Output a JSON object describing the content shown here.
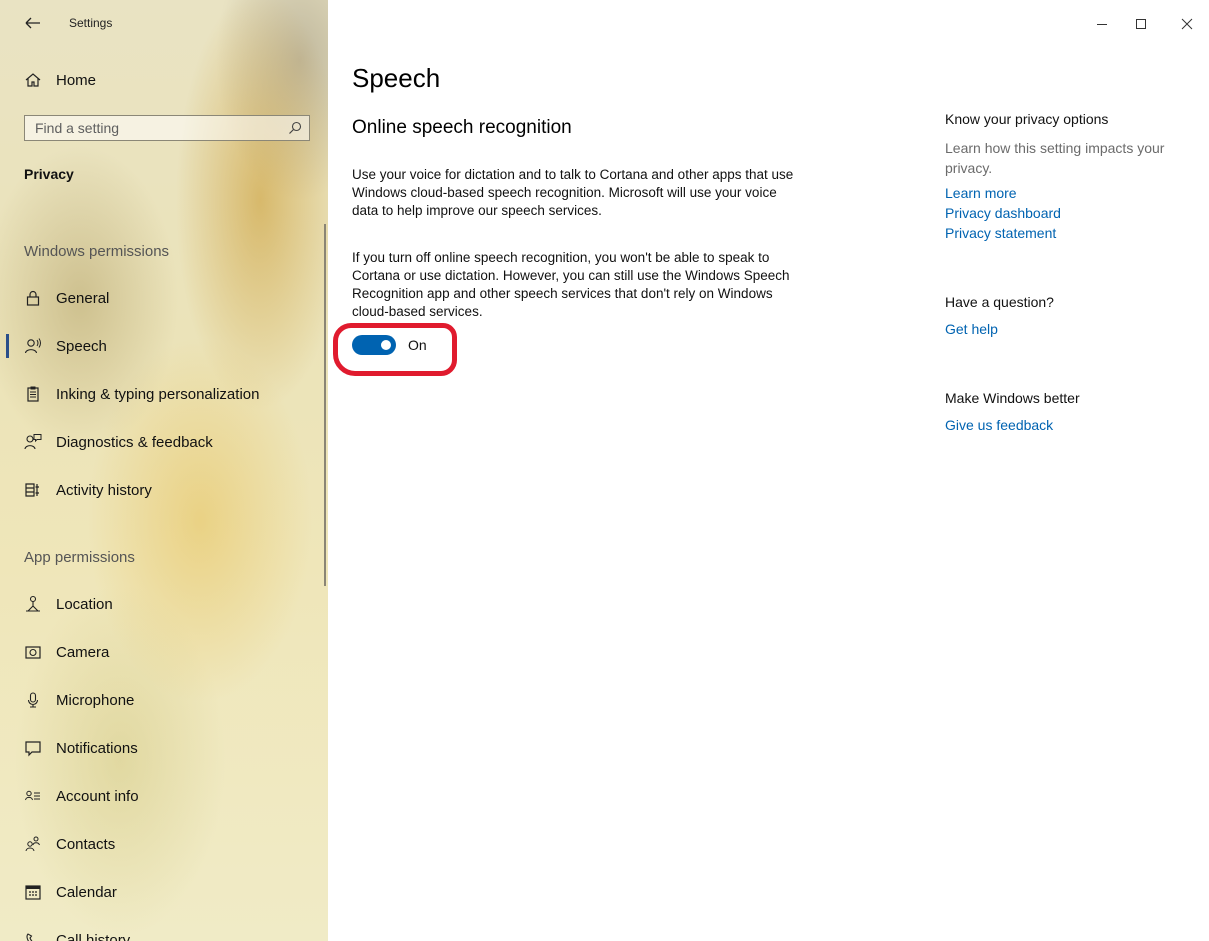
{
  "window": {
    "title": "Settings",
    "controls": {
      "minimize": "minimize",
      "maximize": "maximize",
      "close": "close"
    }
  },
  "sidebar": {
    "home_label": "Home",
    "search_placeholder": "Find a setting",
    "category": "Privacy",
    "sections": [
      {
        "heading": "Windows permissions",
        "items": [
          {
            "label": "General",
            "icon": "lock-icon"
          },
          {
            "label": "Speech",
            "icon": "speech-icon",
            "selected": true
          },
          {
            "label": "Inking & typing personalization",
            "icon": "clipboard-icon"
          },
          {
            "label": "Diagnostics & feedback",
            "icon": "feedback-icon"
          },
          {
            "label": "Activity history",
            "icon": "activity-icon"
          }
        ]
      },
      {
        "heading": "App permissions",
        "items": [
          {
            "label": "Location",
            "icon": "location-icon"
          },
          {
            "label": "Camera",
            "icon": "camera-icon"
          },
          {
            "label": "Microphone",
            "icon": "microphone-icon"
          },
          {
            "label": "Notifications",
            "icon": "notifications-icon"
          },
          {
            "label": "Account info",
            "icon": "account-info-icon"
          },
          {
            "label": "Contacts",
            "icon": "contacts-icon"
          },
          {
            "label": "Calendar",
            "icon": "calendar-icon"
          },
          {
            "label": "Call history",
            "icon": "call-history-icon"
          }
        ]
      }
    ]
  },
  "main": {
    "title": "Speech",
    "subtitle": "Online speech recognition",
    "paragraph1": "Use your voice for dictation and to talk to Cortana and other apps that use Windows cloud-based speech recognition. Microsoft will use your voice data to help improve our speech services.",
    "paragraph2": "If you turn off online speech recognition, you won't be able to speak to Cortana or use dictation. However, you can still use the Windows Speech Recognition app and other speech services that don't rely on Windows cloud-based services.",
    "toggle": {
      "state": "On",
      "on": true
    }
  },
  "right_panel": {
    "privacy_heading": "Know your privacy options",
    "privacy_text": "Learn how this setting impacts your privacy.",
    "links": [
      "Learn more",
      "Privacy dashboard",
      "Privacy statement"
    ],
    "question_heading": "Have a question?",
    "help_link": "Get help",
    "better_heading": "Make Windows better",
    "feedback_link": "Give us feedback"
  },
  "colors": {
    "accent": "#0063b1",
    "annotation": "#e01b2e",
    "selection_bar": "#2a4f8a"
  }
}
